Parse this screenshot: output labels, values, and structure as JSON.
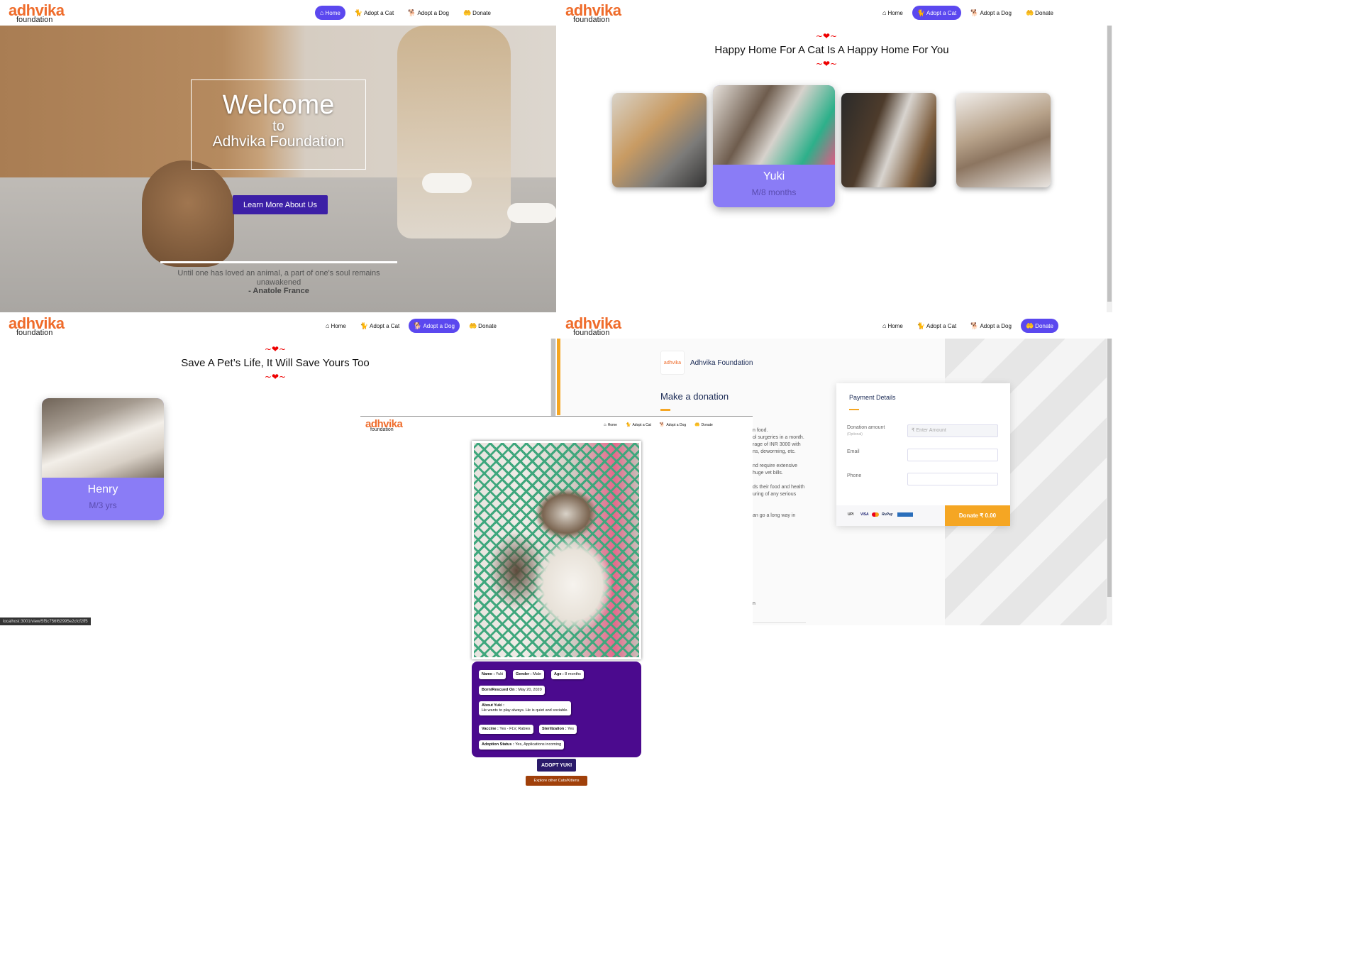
{
  "brand": {
    "line1": "adhvika",
    "line2": "foundation"
  },
  "nav": {
    "home": "Home",
    "adopt_cat": "Adopt a Cat",
    "adopt_dog": "Adopt a Dog",
    "donate": "Donate"
  },
  "hero": {
    "welcome": "Welcome",
    "to": "to",
    "org": "Adhvika Foundation",
    "button": "Learn More About Us",
    "quote": "Until one has loved an animal, a part of one's soul remains unawakened",
    "author": "- Anatole France"
  },
  "hearts": "~❤~",
  "cats_page": {
    "title": "Happy Home For A Cat Is A Happy Home For You",
    "featured": {
      "name": "Yuki",
      "info": "M/8 months"
    }
  },
  "dogs_page": {
    "title": "Save A Pet’s Life, It Will Save Yours Too",
    "featured": {
      "name": "Henry",
      "info": "M/3 yrs"
    },
    "status_url": "localhost:3001/view/5f5c756f62995e2cfcf2ff5"
  },
  "donate_page": {
    "org": "Adhvika Foundation",
    "heading": "Make a donation",
    "payment_title": "Payment Details",
    "amount_label": "Donation amount",
    "amount_hint": "(Optional)",
    "amount_placeholder": "₹ Enter Amount",
    "email_label": "Email",
    "phone_label": "Phone",
    "donate_btn": "Donate  ₹ 0.00",
    "pay_methods": [
      "UPI",
      "VISA",
      "mastercard",
      "RuPay",
      "netbanking"
    ],
    "body_lines": [
      "n food.",
      "ol surgeries in a month.",
      "rage of INR 3000 with",
      "ns, deworming, etc.",
      "",
      "nd require extensive",
      "huge vet bills.",
      "",
      "ds their food and health",
      "uring of any serious",
      "",
      "",
      "an go a long way in"
    ],
    "footer_fragment": "n",
    "accent": "#f5a623"
  },
  "detail": {
    "name_label": "Name :",
    "name": "Yuki",
    "gender_label": "Gender :",
    "gender": "Male",
    "age_label": "Age :",
    "age": "8 months",
    "born_label": "Born/Rescued On :",
    "born": "May 20, 2020",
    "about_label": "About Yuki :",
    "about": "He wants to play always. He is quiet and sociable.",
    "vaccine_label": "Vaccine :",
    "vaccine": "Yes - FLV, Rabies",
    "steril_label": "Sterilization :",
    "steril": "Yes",
    "status_label": "Adoption Status :",
    "status": "Yes, Applications incoming",
    "adopt_btn": "ADOPT YUKI",
    "explore_btn": "Explore other Cats/Kittens"
  },
  "colors": {
    "brand_orange": "#ef6c2b",
    "nav_active": "#5b48ef",
    "card_purple": "#8a7cf6",
    "detail_purple": "#4b0a8e",
    "heart": "#e00000"
  }
}
